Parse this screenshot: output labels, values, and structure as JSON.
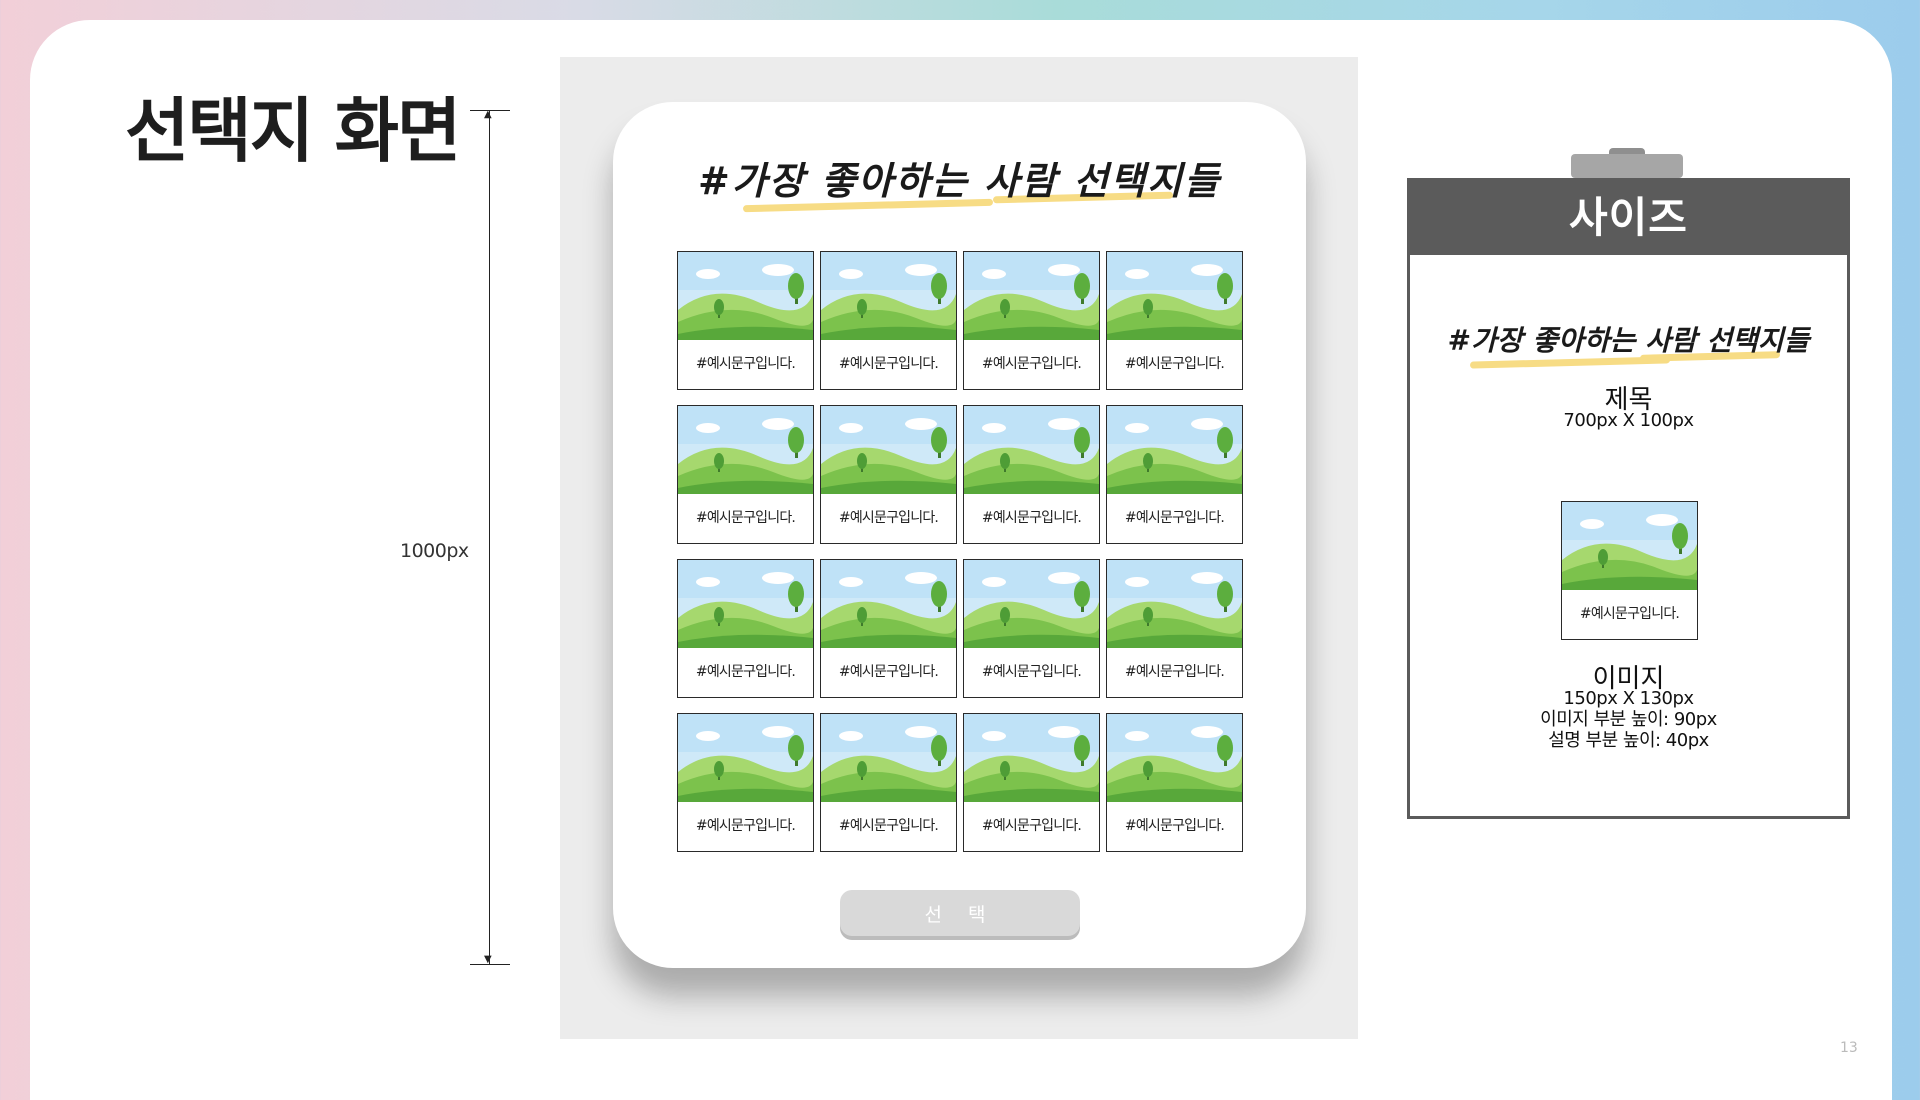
{
  "page": {
    "title": "선택지 화면",
    "number": "13"
  },
  "measurement": {
    "label": "1000px"
  },
  "mockup": {
    "title": "#가장 좋아하는 사람 선택지들",
    "items": [
      "#예시문구입니다.",
      "#예시문구입니다.",
      "#예시문구입니다.",
      "#예시문구입니다.",
      "#예시문구입니다.",
      "#예시문구입니다.",
      "#예시문구입니다.",
      "#예시문구입니다.",
      "#예시문구입니다.",
      "#예시문구입니다.",
      "#예시문구입니다.",
      "#예시문구입니다.",
      "#예시문구입니다.",
      "#예시문구입니다.",
      "#예시문구입니다.",
      "#예시문구입니다."
    ],
    "button_label": "선 택"
  },
  "size_panel": {
    "header": "사이즈",
    "title_sample": "#가장 좋아하는 사람 선택지들",
    "title_label": "제목",
    "title_size": "700px X 100px",
    "image_caption": "#예시문구입니다.",
    "image_label": "이미지",
    "image_size": "150px X 130px",
    "image_height": "이미지 부분 높이: 90px",
    "desc_height": "설명 부분 높이: 40px"
  },
  "colors": {
    "header_gray": "#5b5b5b",
    "highlight": "#f7dc85",
    "button": "#d9d9d9",
    "panel_bg": "#ececec"
  },
  "icons": {
    "card_image": "landscape-illustration"
  }
}
